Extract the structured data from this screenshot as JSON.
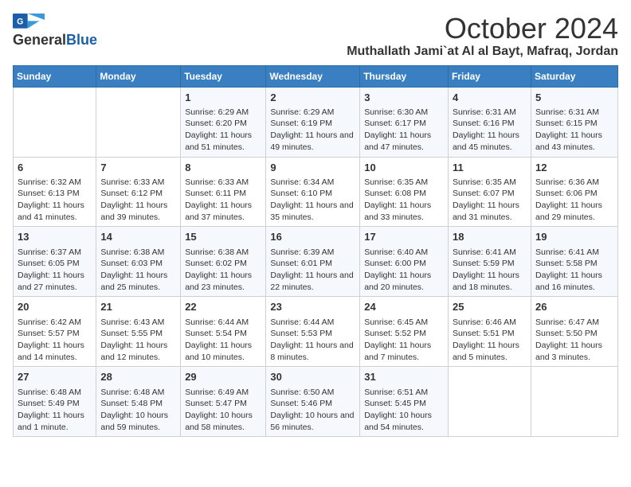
{
  "header": {
    "logo_line1": "General",
    "logo_line2": "Blue",
    "month": "October 2024",
    "location": "Muthallath Jami`at Al al Bayt, Mafraq, Jordan"
  },
  "days_of_week": [
    "Sunday",
    "Monday",
    "Tuesday",
    "Wednesday",
    "Thursday",
    "Friday",
    "Saturday"
  ],
  "weeks": [
    [
      {
        "day": "",
        "info": ""
      },
      {
        "day": "",
        "info": ""
      },
      {
        "day": "1",
        "info": "Sunrise: 6:29 AM\nSunset: 6:20 PM\nDaylight: 11 hours and 51 minutes."
      },
      {
        "day": "2",
        "info": "Sunrise: 6:29 AM\nSunset: 6:19 PM\nDaylight: 11 hours and 49 minutes."
      },
      {
        "day": "3",
        "info": "Sunrise: 6:30 AM\nSunset: 6:17 PM\nDaylight: 11 hours and 47 minutes."
      },
      {
        "day": "4",
        "info": "Sunrise: 6:31 AM\nSunset: 6:16 PM\nDaylight: 11 hours and 45 minutes."
      },
      {
        "day": "5",
        "info": "Sunrise: 6:31 AM\nSunset: 6:15 PM\nDaylight: 11 hours and 43 minutes."
      }
    ],
    [
      {
        "day": "6",
        "info": "Sunrise: 6:32 AM\nSunset: 6:13 PM\nDaylight: 11 hours and 41 minutes."
      },
      {
        "day": "7",
        "info": "Sunrise: 6:33 AM\nSunset: 6:12 PM\nDaylight: 11 hours and 39 minutes."
      },
      {
        "day": "8",
        "info": "Sunrise: 6:33 AM\nSunset: 6:11 PM\nDaylight: 11 hours and 37 minutes."
      },
      {
        "day": "9",
        "info": "Sunrise: 6:34 AM\nSunset: 6:10 PM\nDaylight: 11 hours and 35 minutes."
      },
      {
        "day": "10",
        "info": "Sunrise: 6:35 AM\nSunset: 6:08 PM\nDaylight: 11 hours and 33 minutes."
      },
      {
        "day": "11",
        "info": "Sunrise: 6:35 AM\nSunset: 6:07 PM\nDaylight: 11 hours and 31 minutes."
      },
      {
        "day": "12",
        "info": "Sunrise: 6:36 AM\nSunset: 6:06 PM\nDaylight: 11 hours and 29 minutes."
      }
    ],
    [
      {
        "day": "13",
        "info": "Sunrise: 6:37 AM\nSunset: 6:05 PM\nDaylight: 11 hours and 27 minutes."
      },
      {
        "day": "14",
        "info": "Sunrise: 6:38 AM\nSunset: 6:03 PM\nDaylight: 11 hours and 25 minutes."
      },
      {
        "day": "15",
        "info": "Sunrise: 6:38 AM\nSunset: 6:02 PM\nDaylight: 11 hours and 23 minutes."
      },
      {
        "day": "16",
        "info": "Sunrise: 6:39 AM\nSunset: 6:01 PM\nDaylight: 11 hours and 22 minutes."
      },
      {
        "day": "17",
        "info": "Sunrise: 6:40 AM\nSunset: 6:00 PM\nDaylight: 11 hours and 20 minutes."
      },
      {
        "day": "18",
        "info": "Sunrise: 6:41 AM\nSunset: 5:59 PM\nDaylight: 11 hours and 18 minutes."
      },
      {
        "day": "19",
        "info": "Sunrise: 6:41 AM\nSunset: 5:58 PM\nDaylight: 11 hours and 16 minutes."
      }
    ],
    [
      {
        "day": "20",
        "info": "Sunrise: 6:42 AM\nSunset: 5:57 PM\nDaylight: 11 hours and 14 minutes."
      },
      {
        "day": "21",
        "info": "Sunrise: 6:43 AM\nSunset: 5:55 PM\nDaylight: 11 hours and 12 minutes."
      },
      {
        "day": "22",
        "info": "Sunrise: 6:44 AM\nSunset: 5:54 PM\nDaylight: 11 hours and 10 minutes."
      },
      {
        "day": "23",
        "info": "Sunrise: 6:44 AM\nSunset: 5:53 PM\nDaylight: 11 hours and 8 minutes."
      },
      {
        "day": "24",
        "info": "Sunrise: 6:45 AM\nSunset: 5:52 PM\nDaylight: 11 hours and 7 minutes."
      },
      {
        "day": "25",
        "info": "Sunrise: 6:46 AM\nSunset: 5:51 PM\nDaylight: 11 hours and 5 minutes."
      },
      {
        "day": "26",
        "info": "Sunrise: 6:47 AM\nSunset: 5:50 PM\nDaylight: 11 hours and 3 minutes."
      }
    ],
    [
      {
        "day": "27",
        "info": "Sunrise: 6:48 AM\nSunset: 5:49 PM\nDaylight: 11 hours and 1 minute."
      },
      {
        "day": "28",
        "info": "Sunrise: 6:48 AM\nSunset: 5:48 PM\nDaylight: 10 hours and 59 minutes."
      },
      {
        "day": "29",
        "info": "Sunrise: 6:49 AM\nSunset: 5:47 PM\nDaylight: 10 hours and 58 minutes."
      },
      {
        "day": "30",
        "info": "Sunrise: 6:50 AM\nSunset: 5:46 PM\nDaylight: 10 hours and 56 minutes."
      },
      {
        "day": "31",
        "info": "Sunrise: 6:51 AM\nSunset: 5:45 PM\nDaylight: 10 hours and 54 minutes."
      },
      {
        "day": "",
        "info": ""
      },
      {
        "day": "",
        "info": ""
      }
    ]
  ]
}
